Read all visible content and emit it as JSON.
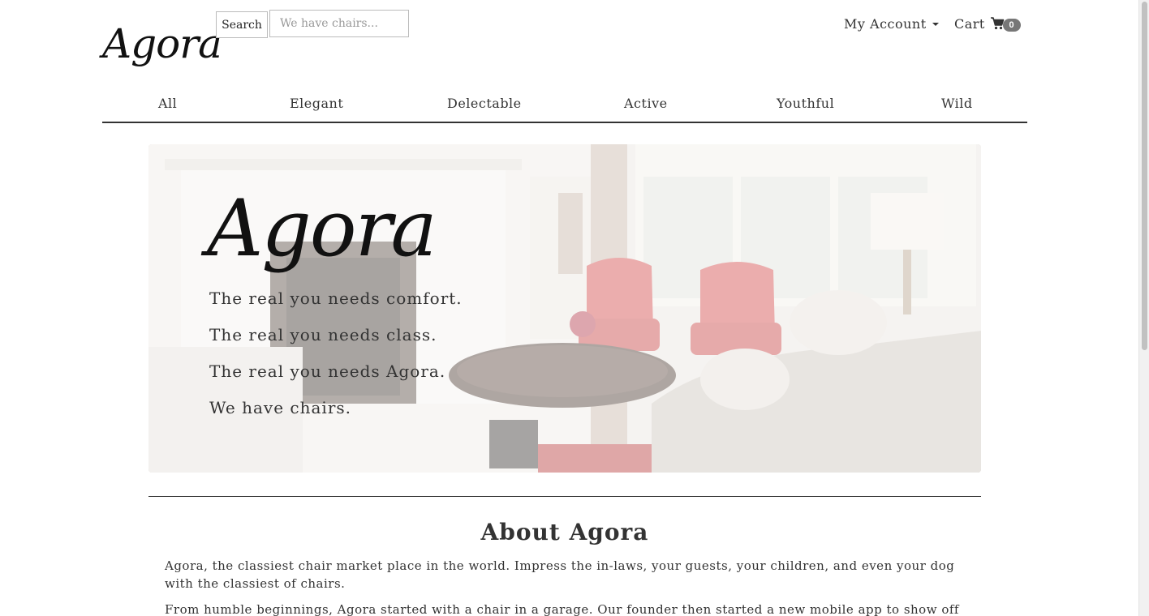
{
  "header": {
    "logo_text": "Agora",
    "search_button": "Search",
    "search_placeholder": "We have chairs...",
    "account_label": "My Account",
    "cart_label": "Cart",
    "cart_count": "0"
  },
  "categories": [
    "All",
    "Elegant",
    "Delectable",
    "Active",
    "Youthful",
    "Wild"
  ],
  "hero": {
    "logo_text": "Agora",
    "taglines": [
      "The real you needs comfort.",
      "The real you needs class.",
      "The real you needs Agora.",
      "We have chairs."
    ]
  },
  "about": {
    "title": "About Agora",
    "paragraphs": [
      "Agora, the classiest chair market place in the world. Impress the in-laws, your guests, your children, and even your dog with the classiest of chairs.",
      "From humble beginnings, Agora started with a chair in a garage. Our founder then started a new mobile app to show off this classy,"
    ]
  },
  "icons": {
    "cart": "shopping-cart-icon",
    "dropdown": "caret-down-icon"
  },
  "colors": {
    "text": "#333333",
    "badge": "#777777",
    "chair_accent": "#d9534f"
  }
}
